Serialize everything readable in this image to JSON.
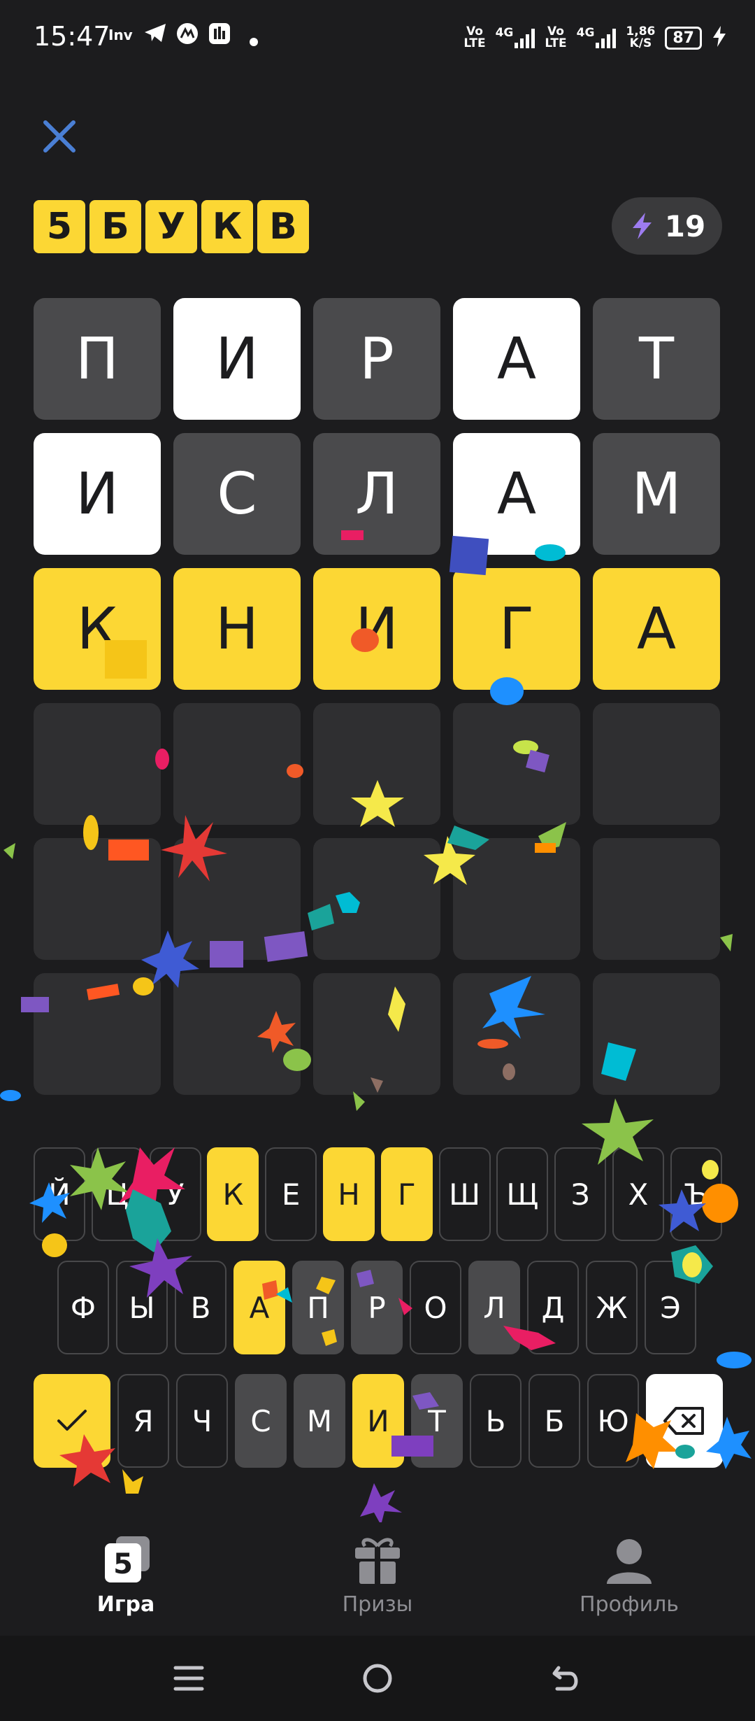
{
  "status_bar": {
    "time": "15:47",
    "left_icons": [
      "Inv",
      "telegram-icon",
      "app-icon",
      "app-icon-2",
      "dot-icon"
    ],
    "signal_1": "Vo LTE",
    "net_1": "4G",
    "signal_2": "Vo LTE",
    "net_2": "4G",
    "speed": "1,86 K/S",
    "battery": "87"
  },
  "header": {
    "title_letters": [
      "5",
      "Б",
      "У",
      "К",
      "В"
    ],
    "energy_count": "19"
  },
  "board": {
    "rows": [
      [
        {
          "l": "П",
          "s": "absent"
        },
        {
          "l": "И",
          "s": "present"
        },
        {
          "l": "Р",
          "s": "absent"
        },
        {
          "l": "А",
          "s": "present"
        },
        {
          "l": "Т",
          "s": "absent"
        }
      ],
      [
        {
          "l": "И",
          "s": "present"
        },
        {
          "l": "С",
          "s": "absent"
        },
        {
          "l": "Л",
          "s": "absent"
        },
        {
          "l": "А",
          "s": "present"
        },
        {
          "l": "М",
          "s": "absent"
        }
      ],
      [
        {
          "l": "К",
          "s": "correct"
        },
        {
          "l": "Н",
          "s": "correct"
        },
        {
          "l": "И",
          "s": "correct"
        },
        {
          "l": "Г",
          "s": "correct"
        },
        {
          "l": "А",
          "s": "correct"
        }
      ],
      [
        {
          "l": "",
          "s": "empty"
        },
        {
          "l": "",
          "s": "empty"
        },
        {
          "l": "",
          "s": "empty"
        },
        {
          "l": "",
          "s": "empty"
        },
        {
          "l": "",
          "s": "empty"
        }
      ],
      [
        {
          "l": "",
          "s": "empty"
        },
        {
          "l": "",
          "s": "empty"
        },
        {
          "l": "",
          "s": "empty"
        },
        {
          "l": "",
          "s": "empty"
        },
        {
          "l": "",
          "s": "empty"
        }
      ],
      [
        {
          "l": "",
          "s": "empty"
        },
        {
          "l": "",
          "s": "empty"
        },
        {
          "l": "",
          "s": "empty"
        },
        {
          "l": "",
          "s": "empty"
        },
        {
          "l": "",
          "s": "empty"
        }
      ]
    ]
  },
  "keyboard": {
    "row1": [
      {
        "k": "Й",
        "s": ""
      },
      {
        "k": "Ц",
        "s": ""
      },
      {
        "k": "У",
        "s": ""
      },
      {
        "k": "К",
        "s": "correct"
      },
      {
        "k": "Е",
        "s": ""
      },
      {
        "k": "Н",
        "s": "correct"
      },
      {
        "k": "Г",
        "s": "correct"
      },
      {
        "k": "Ш",
        "s": ""
      },
      {
        "k": "Щ",
        "s": ""
      },
      {
        "k": "З",
        "s": ""
      },
      {
        "k": "Х",
        "s": ""
      },
      {
        "k": "Ъ",
        "s": ""
      }
    ],
    "row2": [
      {
        "k": "Ф",
        "s": ""
      },
      {
        "k": "Ы",
        "s": ""
      },
      {
        "k": "В",
        "s": ""
      },
      {
        "k": "А",
        "s": "correct"
      },
      {
        "k": "П",
        "s": "absent"
      },
      {
        "k": "Р",
        "s": "absent"
      },
      {
        "k": "О",
        "s": ""
      },
      {
        "k": "Л",
        "s": "absent"
      },
      {
        "k": "Д",
        "s": ""
      },
      {
        "k": "Ж",
        "s": ""
      },
      {
        "k": "Э",
        "s": ""
      }
    ],
    "row3": [
      {
        "k": "Я",
        "s": ""
      },
      {
        "k": "Ч",
        "s": ""
      },
      {
        "k": "С",
        "s": "absent"
      },
      {
        "k": "М",
        "s": "absent"
      },
      {
        "k": "И",
        "s": "correct"
      },
      {
        "k": "Т",
        "s": "absent"
      },
      {
        "k": "Ь",
        "s": ""
      },
      {
        "k": "Б",
        "s": ""
      },
      {
        "k": "Ю",
        "s": ""
      }
    ],
    "enter_icon": "check-icon",
    "backspace_icon": "backspace-icon"
  },
  "bottom_nav": {
    "items": [
      {
        "label": "Игра",
        "icon": "game-icon",
        "active": true
      },
      {
        "label": "Призы",
        "icon": "gift-icon",
        "active": false
      },
      {
        "label": "Профиль",
        "icon": "profile-icon",
        "active": false
      }
    ],
    "game_icon_digit": "5"
  },
  "colors": {
    "correct": "#fcd734",
    "present": "#ffffff",
    "absent": "#4a4a4c",
    "accent_close": "#4a7fd4",
    "energy": "#9d7cf0"
  }
}
